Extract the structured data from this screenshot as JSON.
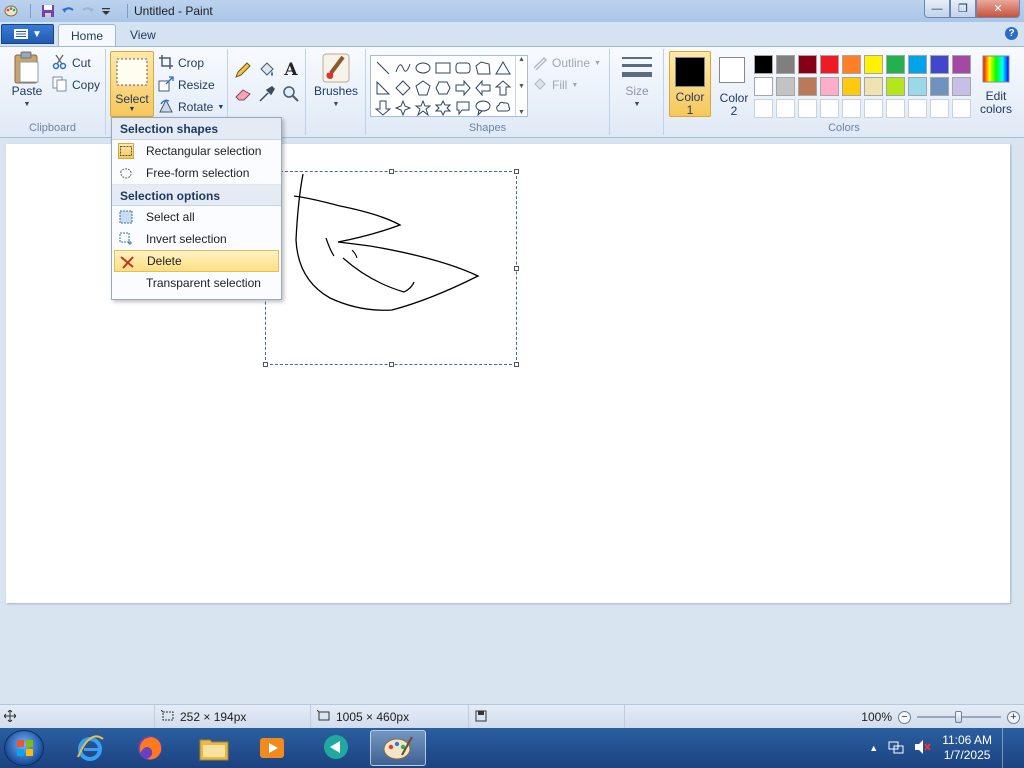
{
  "window": {
    "title": "Untitled - Paint",
    "controls": [
      "minimize",
      "maximize",
      "close"
    ]
  },
  "tabs": {
    "home": "Home",
    "view": "View"
  },
  "ribbon": {
    "clipboard": {
      "label": "Clipboard",
      "paste": "Paste",
      "cut": "Cut",
      "copy": "Copy"
    },
    "image": {
      "select": "Select",
      "crop": "Crop",
      "resize": "Resize",
      "rotate": "Rotate"
    },
    "brushes": "Brushes",
    "shapes": {
      "label": "Shapes",
      "outline": "Outline",
      "fill": "Fill"
    },
    "size": "Size",
    "color1": {
      "label_line1": "Color",
      "label_line2": "1",
      "value": "#000000"
    },
    "color2": {
      "label_line1": "Color",
      "label_line2": "2",
      "value": "#ffffff"
    },
    "colors": {
      "label": "Colors",
      "edit_line1": "Edit",
      "edit_line2": "colors",
      "palette": [
        "#000000",
        "#7f7f7f",
        "#880015",
        "#ed1c24",
        "#ff7f27",
        "#fff200",
        "#22b14c",
        "#00a2e8",
        "#3f48cc",
        "#a349a4",
        "#ffffff",
        "#c3c3c3",
        "#b97a57",
        "#ffaec9",
        "#ffc90e",
        "#efe4b0",
        "#b5e61d",
        "#99d9ea",
        "#7092be",
        "#c8bfe7",
        "#ffffff",
        "#ffffff",
        "#ffffff",
        "#ffffff",
        "#ffffff",
        "#ffffff",
        "#ffffff",
        "#ffffff",
        "#ffffff",
        "#ffffff"
      ]
    }
  },
  "select_menu": {
    "header_shapes": "Selection shapes",
    "items_shapes": [
      {
        "label": "Rectangular selection",
        "icon": "rectangular-selection-icon"
      },
      {
        "label": "Free-form selection",
        "icon": "free-form-selection-icon"
      }
    ],
    "header_options": "Selection options",
    "items_options": [
      {
        "label": "Select all",
        "icon": "select-all-icon"
      },
      {
        "label": "Invert selection",
        "icon": "invert-selection-icon"
      },
      {
        "label": "Delete",
        "icon": "delete-icon"
      },
      {
        "label": "Transparent selection",
        "icon": "transparent-selection-icon"
      }
    ]
  },
  "status": {
    "selection_size": "252 × 194px",
    "canvas_size": "1005 × 460px",
    "zoom": "100%",
    "zoom_level": 0.5
  },
  "taskbar": {
    "time": "11:06 AM",
    "date": "1/7/2025"
  }
}
